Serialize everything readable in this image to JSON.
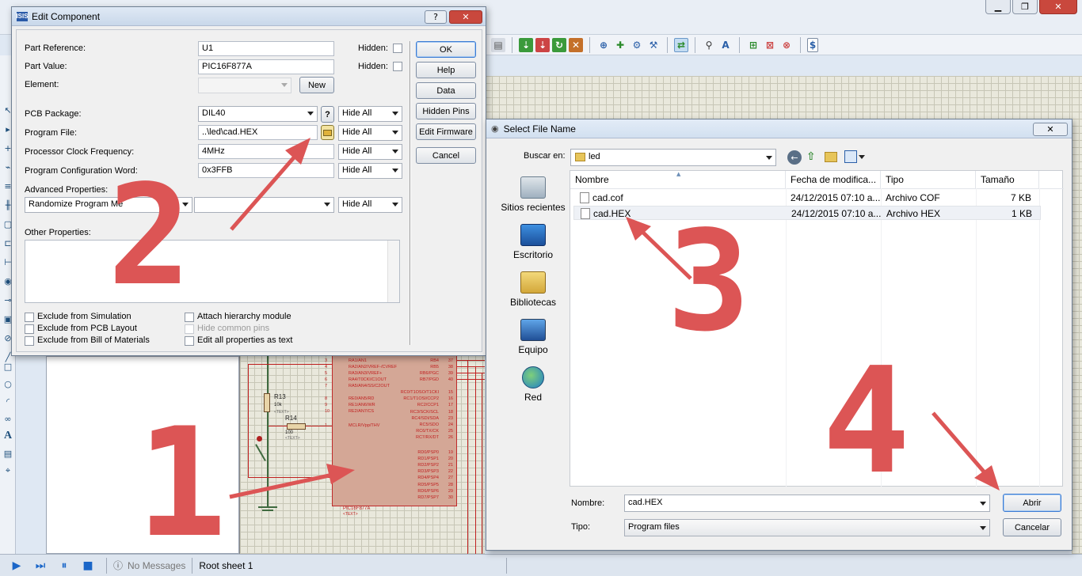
{
  "app": {
    "window_buttons": [
      "▁",
      "❐",
      "✕"
    ],
    "status": {
      "messages": "No Messages",
      "sheet": "Root sheet 1"
    }
  },
  "schematic": {
    "r13": {
      "name": "R13",
      "value": "10k",
      "text": "<TEXT>"
    },
    "r14": {
      "name": "R14",
      "value": "100",
      "text": "<TEXT>"
    },
    "chip": {
      "name": "PIC16F877A",
      "text": "<TEXT>",
      "left_pins": [
        {
          "num": "3",
          "label": "RA1/AN1"
        },
        {
          "num": "4",
          "label": "RA2/AN2/VREF-/CVREF"
        },
        {
          "num": "5",
          "label": "RA3/AN3/VREF+"
        },
        {
          "num": "6",
          "label": "RA4/T0CKI/C1OUT"
        },
        {
          "num": "7",
          "label": "RA5/AN4/SS/C2OUT"
        },
        {
          "num": "8",
          "label": "RE0/AN5/RD"
        },
        {
          "num": "9",
          "label": "RE1/AN6/WR"
        },
        {
          "num": "10",
          "label": "RE2/AN7/CS"
        },
        {
          "num": "1",
          "label": "MCLR/Vpp/THV"
        }
      ],
      "right_pins": [
        {
          "num": "37",
          "label": "RB4"
        },
        {
          "num": "38",
          "label": "RB5"
        },
        {
          "num": "39",
          "label": "RB6/PGC"
        },
        {
          "num": "40",
          "label": "RB7/PGD"
        },
        {
          "num": "15",
          "label": "RC0/T1OSO/T1CKI"
        },
        {
          "num": "16",
          "label": "RC1/T1OSI/CCP2"
        },
        {
          "num": "17",
          "label": "RC2/CCP1"
        },
        {
          "num": "18",
          "label": "RC3/SCK/SCL"
        },
        {
          "num": "23",
          "label": "RC4/SDI/SDA"
        },
        {
          "num": "24",
          "label": "RC5/SDO"
        },
        {
          "num": "25",
          "label": "RC6/TX/CK"
        },
        {
          "num": "26",
          "label": "RC7/RX/DT"
        },
        {
          "num": "19",
          "label": "RD0/PSP0"
        },
        {
          "num": "20",
          "label": "RD1/PSP1"
        },
        {
          "num": "21",
          "label": "RD2/PSP2"
        },
        {
          "num": "22",
          "label": "RD3/PSP3"
        },
        {
          "num": "27",
          "label": "RD4/PSP4"
        },
        {
          "num": "28",
          "label": "RD5/PSP5"
        },
        {
          "num": "29",
          "label": "RD6/PSP6"
        },
        {
          "num": "30",
          "label": "RD7/PSP7"
        }
      ]
    }
  },
  "edit_dialog": {
    "title": "Edit Component",
    "title_icon": "ISIS",
    "help_btn": "?",
    "close_btn": "✕",
    "part_reference": {
      "label": "Part Reference:",
      "value": "U1",
      "hidden_label": "Hidden:"
    },
    "part_value": {
      "label": "Part Value:",
      "value": "PIC16F877A",
      "hidden_label": "Hidden:"
    },
    "element": {
      "label": "Element:",
      "value": "",
      "new_btn": "New"
    },
    "pcb_package": {
      "label": "PCB Package:",
      "value": "DIL40",
      "help": "?",
      "visibility": "Hide All"
    },
    "program_file": {
      "label": "Program File:",
      "value": "..\\led\\cad.HEX",
      "visibility": "Hide All"
    },
    "clock": {
      "label": "Processor Clock Frequency:",
      "value": "4MHz",
      "visibility": "Hide All"
    },
    "config_word": {
      "label": "Program Configuration Word:",
      "value": "0x3FFB",
      "visibility": "Hide All"
    },
    "advanced": {
      "label": "Advanced Properties:",
      "property": "Randomize Program Me",
      "value": "",
      "visibility": "Hide All"
    },
    "other": {
      "label": "Other Properties:"
    },
    "checkboxes": {
      "exclude_sim": "Exclude from Simulation",
      "exclude_pcb": "Exclude from PCB Layout",
      "exclude_bom": "Exclude from Bill of Materials",
      "attach_hier": "Attach hierarchy module",
      "hide_pins": "Hide common pins",
      "edit_all": "Edit all properties as text"
    },
    "buttons": {
      "ok": "OK",
      "help": "Help",
      "data": "Data",
      "hidden_pins": "Hidden Pins",
      "edit_firmware": "Edit Firmware",
      "cancel": "Cancel"
    }
  },
  "file_dialog": {
    "title": "Select File Name",
    "close_btn": "✕",
    "look_in_label": "Buscar en:",
    "look_in_value": "led",
    "places": [
      "Sitios recientes",
      "Escritorio",
      "Bibliotecas",
      "Equipo",
      "Red"
    ],
    "columns": [
      "Nombre",
      "Fecha de modifica...",
      "Tipo",
      "Tamaño"
    ],
    "files": [
      {
        "name": "cad.cof",
        "date": "24/12/2015 07:10 a...",
        "type": "Archivo COF",
        "size": "7 KB"
      },
      {
        "name": "cad.HEX",
        "date": "24/12/2015 07:10 a...",
        "type": "Archivo HEX",
        "size": "1 KB"
      }
    ],
    "name_label": "Nombre:",
    "name_value": "cad.HEX",
    "type_label": "Tipo:",
    "type_value": "Program files",
    "open_btn": "Abrir",
    "cancel_btn": "Cancelar"
  },
  "annotations": [
    "1",
    "2",
    "3",
    "4"
  ],
  "colors": {
    "annotation": "#dc5555",
    "schematic_red": "#c02020",
    "chip_fill": "#d4a796",
    "grid": "#e9e8dc"
  }
}
